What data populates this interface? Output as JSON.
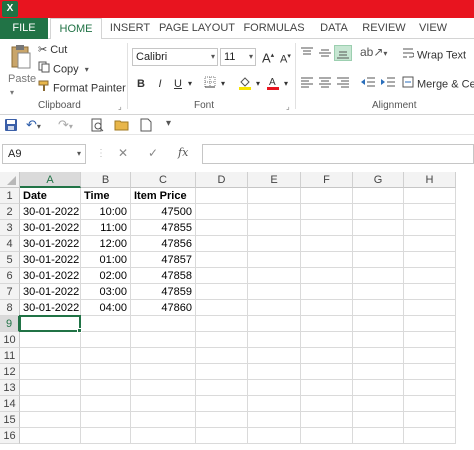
{
  "ribbon_tabs": [
    {
      "label": "FILE"
    },
    {
      "label": "HOME"
    },
    {
      "label": "INSERT"
    },
    {
      "label": "PAGE LAYOUT"
    },
    {
      "label": "FORMULAS"
    },
    {
      "label": "DATA"
    },
    {
      "label": "REVIEW"
    },
    {
      "label": "VIEW"
    }
  ],
  "clipboard": {
    "paste": "Paste",
    "cut": "Cut",
    "copy": "Copy",
    "format_painter": "Format Painter",
    "group_label": "Clipboard"
  },
  "font": {
    "family": "Calibri",
    "size": "11",
    "bold": "B",
    "italic": "I",
    "underline": "U",
    "group_label": "Font"
  },
  "alignment": {
    "wrap_text": "Wrap Text",
    "merge_center": "Merge & Ce",
    "group_label": "Alignment"
  },
  "formula_bar": {
    "name_box": "A9",
    "fx": "fx",
    "cancel": "✕",
    "enter": "✓",
    "formula": ""
  },
  "columns": [
    "A",
    "B",
    "C",
    "D",
    "E",
    "F",
    "G",
    "H"
  ],
  "rows": [
    "1",
    "2",
    "3",
    "4",
    "5",
    "6",
    "7",
    "8",
    "9",
    "10",
    "11",
    "12",
    "13",
    "14",
    "15",
    "16"
  ],
  "sheet": {
    "headers": [
      "Date",
      "Time",
      "Item Price"
    ],
    "records": [
      [
        "30-01-2022",
        "10:00",
        "47500"
      ],
      [
        "30-01-2022",
        "11:00",
        "47855"
      ],
      [
        "30-01-2022",
        "12:00",
        "47856"
      ],
      [
        "30-01-2022",
        "01:00",
        "47857"
      ],
      [
        "30-01-2022",
        "02:00",
        "47858"
      ],
      [
        "30-01-2022",
        "03:00",
        "47859"
      ],
      [
        "30-01-2022",
        "04:00",
        "47860"
      ]
    ]
  },
  "colors": {
    "title_bar": "#e8141f",
    "excel_green": "#217346",
    "fill_highlight": "#f7e400",
    "font_color": "#e8141f"
  },
  "icons": {
    "app": "excel-logo-icon",
    "save": "save-icon",
    "undo": "undo-icon",
    "redo": "redo-icon"
  }
}
